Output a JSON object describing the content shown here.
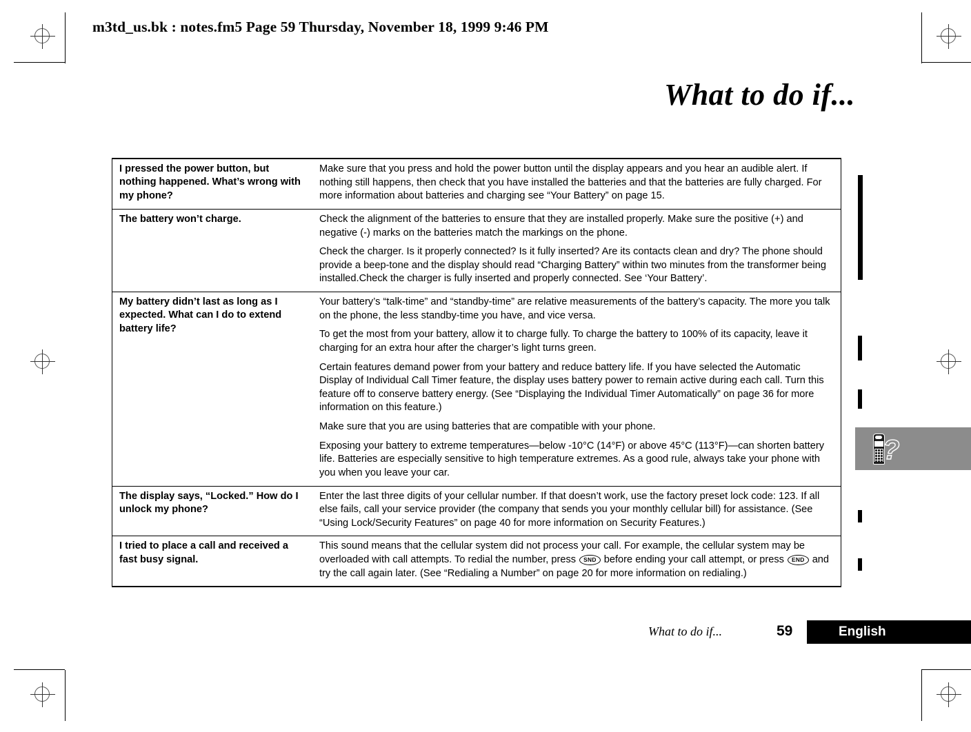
{
  "page_header": "m3td_us.bk : notes.fm5  Page 59  Thursday, November 18, 1999  9:46 PM",
  "chapter_title": "What to do if...",
  "faq": {
    "rows": [
      {
        "question": "I pressed the power button, but nothing happened. What’s wrong with my phone?",
        "answers": [
          "Make sure that you press and hold the power button until the display appears and you hear an audible alert. If nothing still happens, then check that you have installed the batteries and that the batteries are fully charged. For more information about batteries and charging see “Your Battery” on page 15."
        ]
      },
      {
        "question": "The battery won’t charge.",
        "answers": [
          "Check the alignment of the batteries to ensure that they are installed properly. Make sure the positive (+) and negative (-) marks on the batteries match the markings on the phone.",
          "Check the charger. Is it properly connected? Is it fully inserted? Are its contacts clean and dry? The phone should provide a beep-tone and the display should read “Charging Battery” within two minutes from the transformer being installed.Check the charger is fully inserted and properly connected. See ‘Your Battery’."
        ]
      },
      {
        "question": "My battery didn’t last as long as I expected. What can I do to extend battery life?",
        "answers": [
          "Your battery’s “talk-time” and “standby-time” are relative measurements of the battery’s capacity. The more you talk on the phone, the less standby-time you have, and vice versa.",
          "To get the most from your battery, allow it to charge fully. To charge the battery to 100% of its capacity, leave it charging for an extra hour after the charger’s light turns green.",
          "Certain features demand power from your battery and reduce battery life. If you have selected the Automatic Display of Individual Call Timer feature, the display uses battery power to remain active during each call. Turn this feature off to conserve battery energy. (See “Displaying the Individual Timer Automatically” on page 36 for more information on this feature.)",
          "Make sure that you are using batteries that are compatible with your phone.",
          "Exposing your battery to extreme temperatures—below -10°C (14°F) or above 45°C (113°F)—can shorten battery life. Batteries are especially sensitive to high temperature extremes. As a good rule, always take your phone with you when you leave your car."
        ]
      },
      {
        "question": "The display says, “Locked.” How do I unlock my phone?",
        "answers": [
          "Enter the last three digits of your cellular number. If that doesn’t work, use the factory preset lock code: 123. If all else fails, call your service provider (the company that sends you your monthly cellular bill) for assistance. (See “Using Lock/Security Features” on page 40 for more information on Security Features.)"
        ]
      },
      {
        "question": "I tried to place a call and received a fast busy signal.",
        "answers_rich": {
          "part1": "This sound means that the cellular system did not process your call. For example, the cellular system may be overloaded with call attempts. To redial the number, press ",
          "key_send": "SND",
          "part2": " before ending your call attempt, or press ",
          "key_end": "END",
          "part3": " and try the call again later. (See “Redialing a Number” on page 20 for more information on redialing.)"
        }
      }
    ]
  },
  "footer": {
    "running_title": "What to do if...",
    "page_number": "59",
    "language": "English"
  },
  "side_tab": {
    "icon": "phone-question-icon"
  }
}
